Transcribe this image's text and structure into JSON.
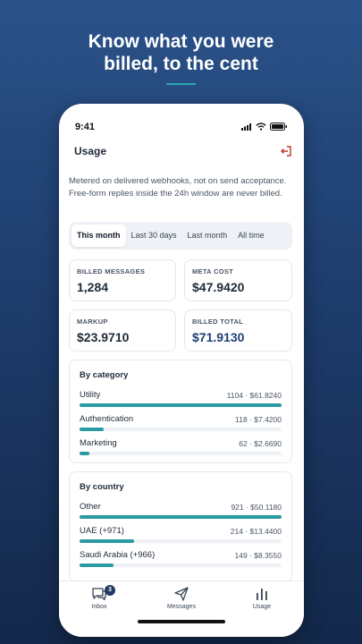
{
  "headline": {
    "line1": "Know what you were",
    "line2": "billed, to the cent"
  },
  "status_bar": {
    "time": "9:41"
  },
  "page": {
    "title": "Usage"
  },
  "description": "Metered on delivered webhooks, not on send acceptance. Free-form replies inside the 24h window are never billed.",
  "tabs": [
    {
      "label": "This month",
      "active": true
    },
    {
      "label": "Last 30 days",
      "active": false
    },
    {
      "label": "Last month",
      "active": false
    },
    {
      "label": "All time",
      "active": false
    }
  ],
  "stats": [
    {
      "label": "BILLED MESSAGES",
      "value": "1,284"
    },
    {
      "label": "META COST",
      "value": "$47.9420"
    },
    {
      "label": "MARKUP",
      "value": "$23.9710"
    },
    {
      "label": "BILLED TOTAL",
      "value": "$71.9130"
    }
  ],
  "by_category": {
    "title": "By category",
    "rows": [
      {
        "label": "Utility",
        "value": "1104 · $61.8240",
        "fraction": 1.0
      },
      {
        "label": "Authentication",
        "value": "118 · $7.4200",
        "fraction": 0.12
      },
      {
        "label": "Marketing",
        "value": "62 · $2.6690",
        "fraction": 0.05
      }
    ]
  },
  "by_country": {
    "title": "By country",
    "rows": [
      {
        "label": "Other",
        "value": "921 · $50.1180",
        "fraction": 1.0
      },
      {
        "label": "UAE (+971)",
        "value": "214 · $13.4400",
        "fraction": 0.27
      },
      {
        "label": "Saudi Arabia (+966)",
        "value": "149 · $8.3550",
        "fraction": 0.17
      }
    ]
  },
  "nav": {
    "inbox": {
      "label": "Inbox",
      "badge": "3"
    },
    "messages": {
      "label": "Messages"
    },
    "usage": {
      "label": "Usage"
    }
  },
  "colors": {
    "accent": "#2a9aa3",
    "brand": "#1f3a64",
    "logout": "#c0392b"
  },
  "icons": [
    "signal-icon",
    "wifi-icon",
    "battery-icon",
    "logout-icon",
    "chat-icon",
    "send-icon",
    "bar-chart-icon"
  ]
}
